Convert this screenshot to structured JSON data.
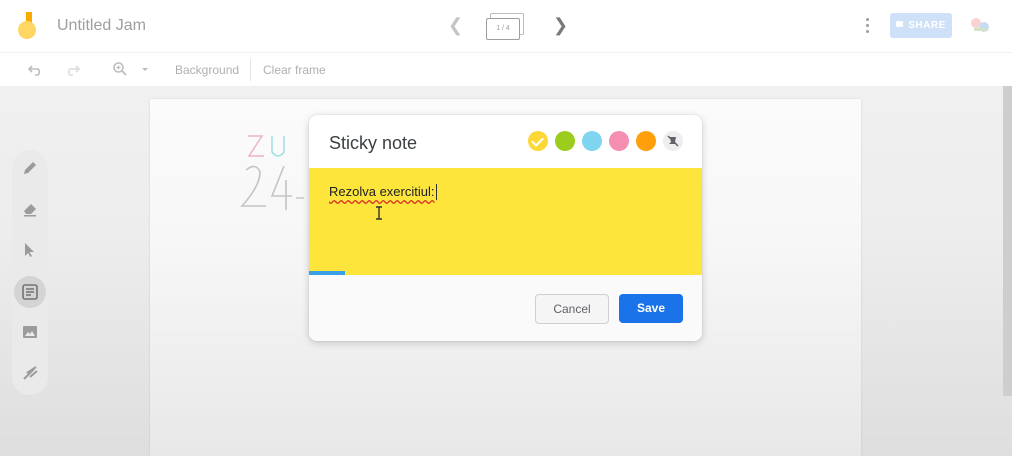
{
  "app": {
    "title": "Untitled Jam",
    "frame_indicator": "1 / 4",
    "share_label": "SHARE"
  },
  "toolbar": {
    "background_label": "Background",
    "clear_frame_label": "Clear frame",
    "icons": [
      "undo-icon",
      "redo-icon",
      "zoom-icon",
      "dropdown-icon"
    ]
  },
  "left_tools": [
    "pen-icon",
    "eraser-icon",
    "select-icon",
    "sticky-note-icon",
    "image-icon",
    "laser-icon"
  ],
  "left_tools_active": "sticky-note-icon",
  "dialog": {
    "title": "Sticky note",
    "note_text": "Rezolva exercitiul:",
    "cancel_label": "Cancel",
    "save_label": "Save",
    "colors": [
      {
        "name": "yellow",
        "hex": "#fdd835",
        "selected": true
      },
      {
        "name": "green",
        "hex": "#9ccc1d"
      },
      {
        "name": "blue",
        "hex": "#7fd4f0"
      },
      {
        "name": "pink",
        "hex": "#f48fb1"
      },
      {
        "name": "orange",
        "hex": "#ff9f0a"
      }
    ],
    "note_color": "#fde53b",
    "accent": "#1a73e8"
  }
}
